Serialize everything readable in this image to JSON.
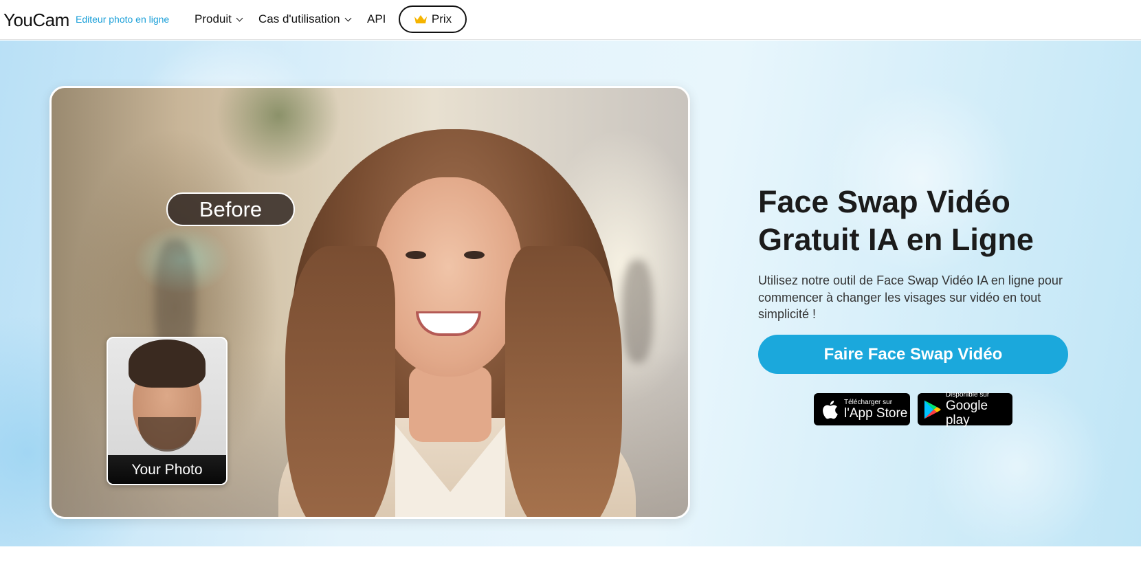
{
  "nav": {
    "logo": "YouCam",
    "logo_sub": "Editeur photo en ligne",
    "items": [
      {
        "label": "Produit",
        "has_dropdown": true
      },
      {
        "label": "Cas d'utilisation",
        "has_dropdown": true
      },
      {
        "label": "API",
        "has_dropdown": false
      }
    ],
    "price_label": "Prix"
  },
  "hero": {
    "before_label": "Before",
    "your_photo_label": "Your Photo",
    "title_line1": "Face Swap Vidéo",
    "title_line2": "Gratuit IA en Ligne",
    "description": "Utilisez notre outil de Face Swap Vidéo IA en ligne pour commencer à changer les visages sur vidéo en tout simplicité !",
    "cta_label": "Faire Face Swap Vidéo",
    "app_store": {
      "small": "Télécharger sur",
      "big": "l'App Store"
    },
    "google_play": {
      "small": "Disponible sur",
      "big": "Google play"
    }
  },
  "colors": {
    "accent": "#1ba8dc",
    "logo_sub": "#1a9fd8",
    "crown": "#f5b400"
  },
  "icons": [
    "chevron-down-icon",
    "crown-icon",
    "apple-icon",
    "google-play-icon"
  ]
}
